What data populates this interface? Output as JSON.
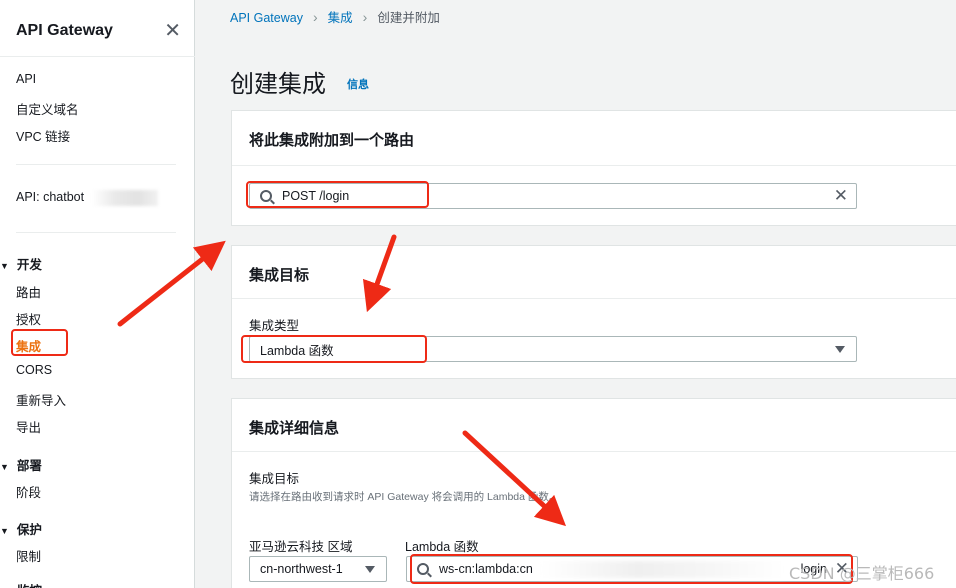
{
  "sidebar": {
    "title": "API Gateway",
    "close_glyph": "✕",
    "top_links": [
      "API",
      "自定义域名",
      "VPC 链接"
    ],
    "api_label": "API: chatbot",
    "groups": [
      {
        "label": "开发",
        "items": [
          "路由",
          "授权",
          "集成",
          "CORS",
          "重新导入",
          "导出"
        ]
      },
      {
        "label": "部署",
        "items": [
          "阶段"
        ]
      },
      {
        "label": "保护",
        "items": [
          "限制"
        ]
      },
      {
        "label": "监控",
        "items": []
      }
    ],
    "active_item": "集成"
  },
  "breadcrumb": {
    "items": [
      "API Gateway",
      "集成",
      "创建并附加"
    ],
    "separator": "〉"
  },
  "page": {
    "title": "创建集成",
    "info_link": "信息"
  },
  "attach_panel": {
    "title": "将此集成附加到一个路由",
    "route_value": "POST /login",
    "clear_glyph": "✕"
  },
  "target_panel": {
    "title": "集成目标",
    "type_label": "集成类型",
    "type_value": "Lambda 函数"
  },
  "details_panel": {
    "title": "集成详细信息",
    "target_label": "集成目标",
    "target_desc": "请选择在路由收到请求时 API Gateway 将会调用的 Lambda 函数。",
    "region_label": "亚马逊云科技 区域",
    "region_value": "cn-northwest-1",
    "lambda_label": "Lambda 函数",
    "lambda_value_prefix": "ws-cn:lambda:cn",
    "lambda_value_suffix": "login",
    "clear_glyph": "✕"
  },
  "watermark": "CSDN @三掌柜666",
  "colors": {
    "accent_orange": "#ec7211",
    "link_blue": "#0073bb",
    "annotation_red": "#ee2a16",
    "page_bg": "#f2f3f3"
  }
}
